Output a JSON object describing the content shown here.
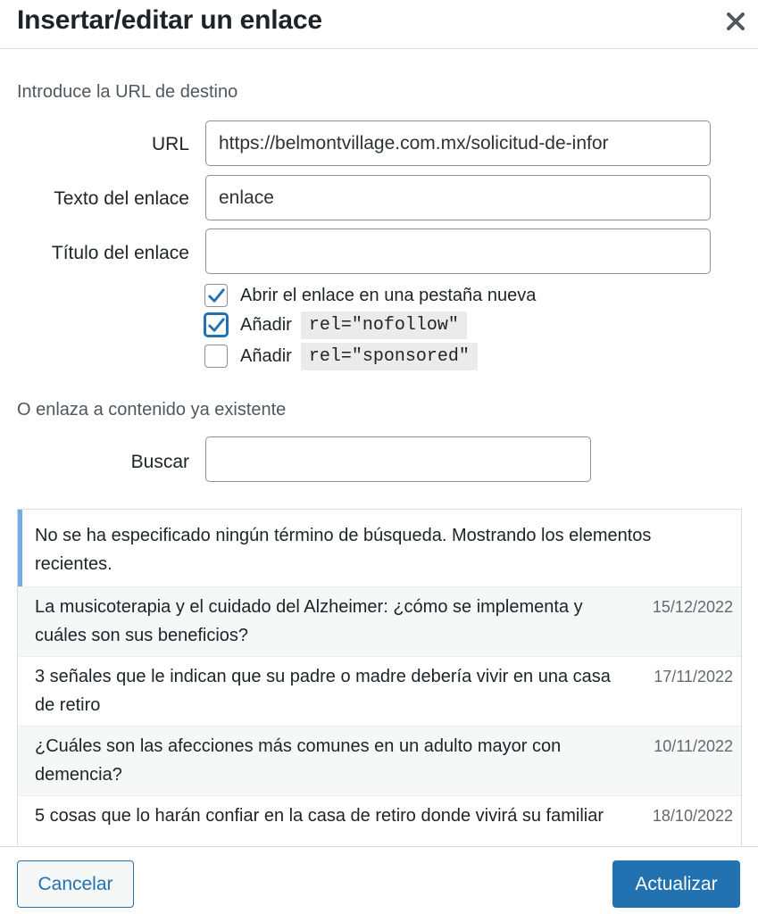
{
  "dialog": {
    "title": "Insertar/editar un enlace",
    "close_icon": "close-icon"
  },
  "destination": {
    "heading": "Introduce la URL de destino",
    "url_label": "URL",
    "url_value": "https://belmontvillage.com.mx/solicitud-de-infor",
    "link_text_label": "Texto del enlace",
    "link_text_value": "enlace",
    "link_title_label": "Título del enlace",
    "link_title_value": ""
  },
  "options": [
    {
      "label": "Abrir el enlace en una pestaña nueva",
      "code": "",
      "checked": true
    },
    {
      "label": "Añadir",
      "code": "rel=\"nofollow\"",
      "checked": true
    },
    {
      "label": "Añadir",
      "code": "rel=\"sponsored\"",
      "checked": false
    }
  ],
  "existing": {
    "heading": "O enlaza a contenido ya existente",
    "search_label": "Buscar",
    "search_value": "",
    "notice": "No se ha especificado ningún término de búsqueda. Mostrando los elementos recientes.",
    "results": [
      {
        "title": "La musicoterapia y el cuidado del Alzheimer: ¿cómo se implementa y cuáles son sus beneficios?",
        "date": "15/12/2022"
      },
      {
        "title": "3 señales que le indican que su padre o madre debería vivir en una casa de retiro",
        "date": "17/11/2022"
      },
      {
        "title": "¿Cuáles son las afecciones más comunes en un adulto mayor con demencia?",
        "date": "10/11/2022"
      },
      {
        "title": "5 cosas que lo harán confiar en la casa de retiro donde vivirá su familiar",
        "date": "18/10/2022"
      }
    ]
  },
  "footer": {
    "cancel_label": "Cancelar",
    "submit_label": "Actualizar"
  },
  "colors": {
    "accent": "#2271b1",
    "notice_border": "#72aee6",
    "text": "#1d2327"
  }
}
